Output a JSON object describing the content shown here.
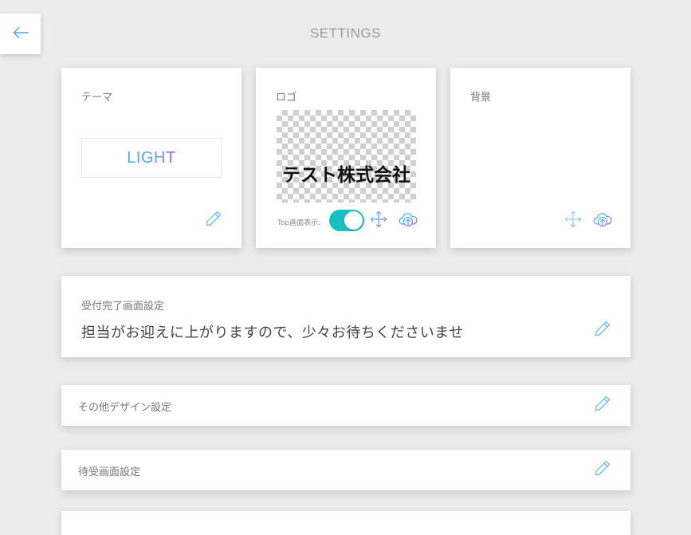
{
  "header": {
    "title": "SETTINGS",
    "back_icon": "arrow-left-icon"
  },
  "theme_card": {
    "label": "テーマ",
    "value": "LIGHT",
    "edit_icon": "pencil-icon"
  },
  "logo_card": {
    "label": "ロゴ",
    "logo_text": "テスト株式会社",
    "top_display_label": "Top画面表示:",
    "top_display_enabled": true,
    "move_icon": "move-arrows-icon",
    "upload_icon": "cloud-upload-icon"
  },
  "background_card": {
    "label": "背景",
    "move_icon": "move-arrows-icon",
    "upload_icon": "cloud-upload-icon"
  },
  "reception_card": {
    "label": "受付完了画面設定",
    "message": "担当がお迎えに上がりますので、少々お待ちくださいませ",
    "edit_icon": "pencil-icon"
  },
  "other_design_card": {
    "label": "その他デザイン設定",
    "edit_icon": "pencil-icon"
  },
  "standby_card": {
    "label": "待受画面設定",
    "edit_icon": "pencil-icon"
  },
  "colors": {
    "accent_blue": "#3fb6f0",
    "accent_purple": "#c350e8",
    "toggle_on": "#16bfc0",
    "background": "#ececec"
  }
}
